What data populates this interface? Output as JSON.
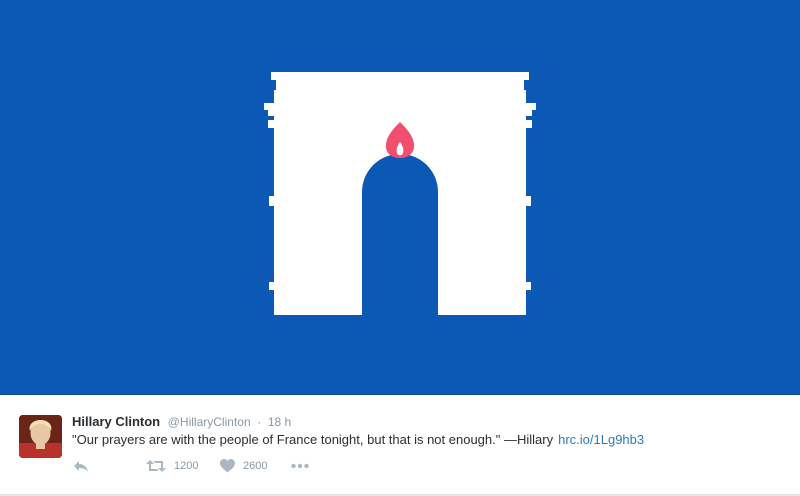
{
  "colors": {
    "media_background": "#0c58b5",
    "arch": "#ffffff",
    "flame": "#f0506e",
    "flame_core": "#ffffff",
    "text_primary": "#292f33",
    "text_secondary": "#8899a6",
    "link": "#2b7bb9",
    "action_icon": "#aab8c2"
  },
  "tweet": {
    "author_name": "Hillary Clinton",
    "author_handle": "@HillaryClinton",
    "separator": "·",
    "timestamp": "18 h",
    "text": "\"Our prayers are with the people of France tonight, but that is not enough.\" —Hillary",
    "link_text": "hrc.io/1Lg9hb3",
    "media": {
      "description_icon": "arc-de-triomphe-candle-icon"
    },
    "actions": {
      "reply_icon": "reply-icon",
      "retweet_icon": "retweet-icon",
      "retweet_count": "1200",
      "like_icon": "heart-icon",
      "like_count": "2600",
      "more_icon": "more-dots-icon"
    }
  }
}
